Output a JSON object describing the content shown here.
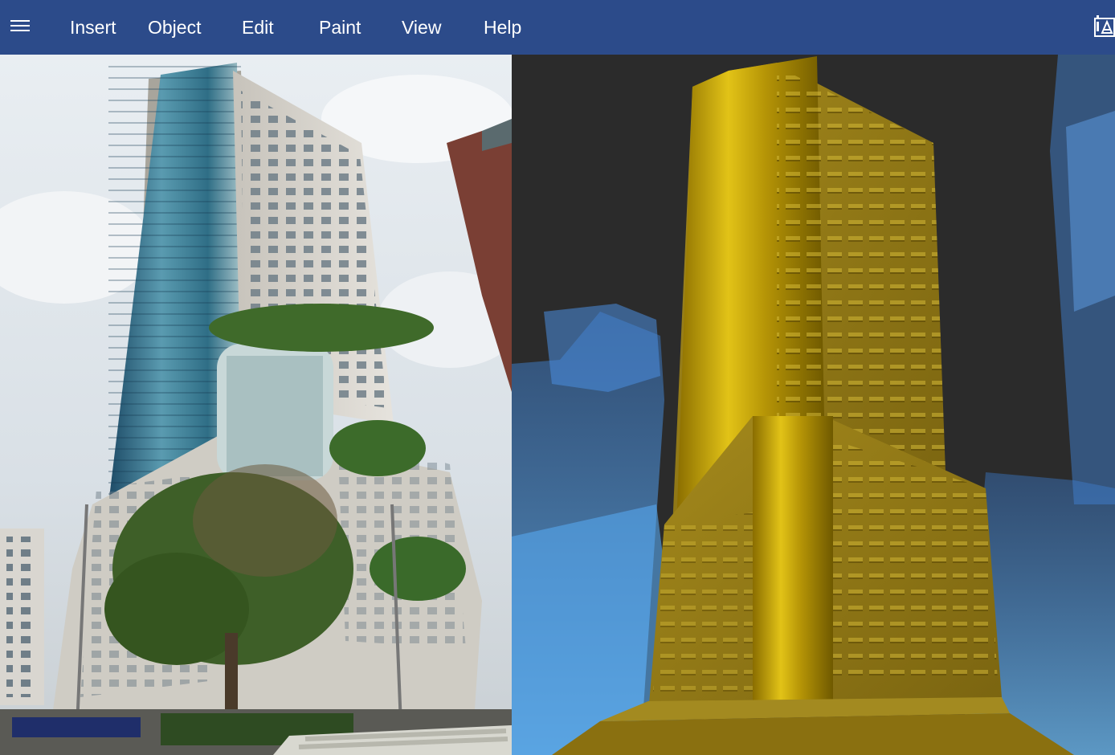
{
  "menubar": {
    "hamburger_icon": "hamburger-menu-icon",
    "items": [
      {
        "label": "Insert"
      },
      {
        "label": "Object"
      },
      {
        "label": "Edit"
      },
      {
        "label": "Paint"
      },
      {
        "label": "View"
      },
      {
        "label": "Help"
      }
    ],
    "corner_icon": "image-compare-icon",
    "background_color": "#2c4b8a",
    "text_color": "#ffffff"
  },
  "viewport": {
    "left_pane": "reference-photo",
    "right_pane": "3d-model-render",
    "model_color": "#c9a600",
    "context_buildings_color": "#3b8fe6",
    "model_background": "#2b2b2b"
  }
}
